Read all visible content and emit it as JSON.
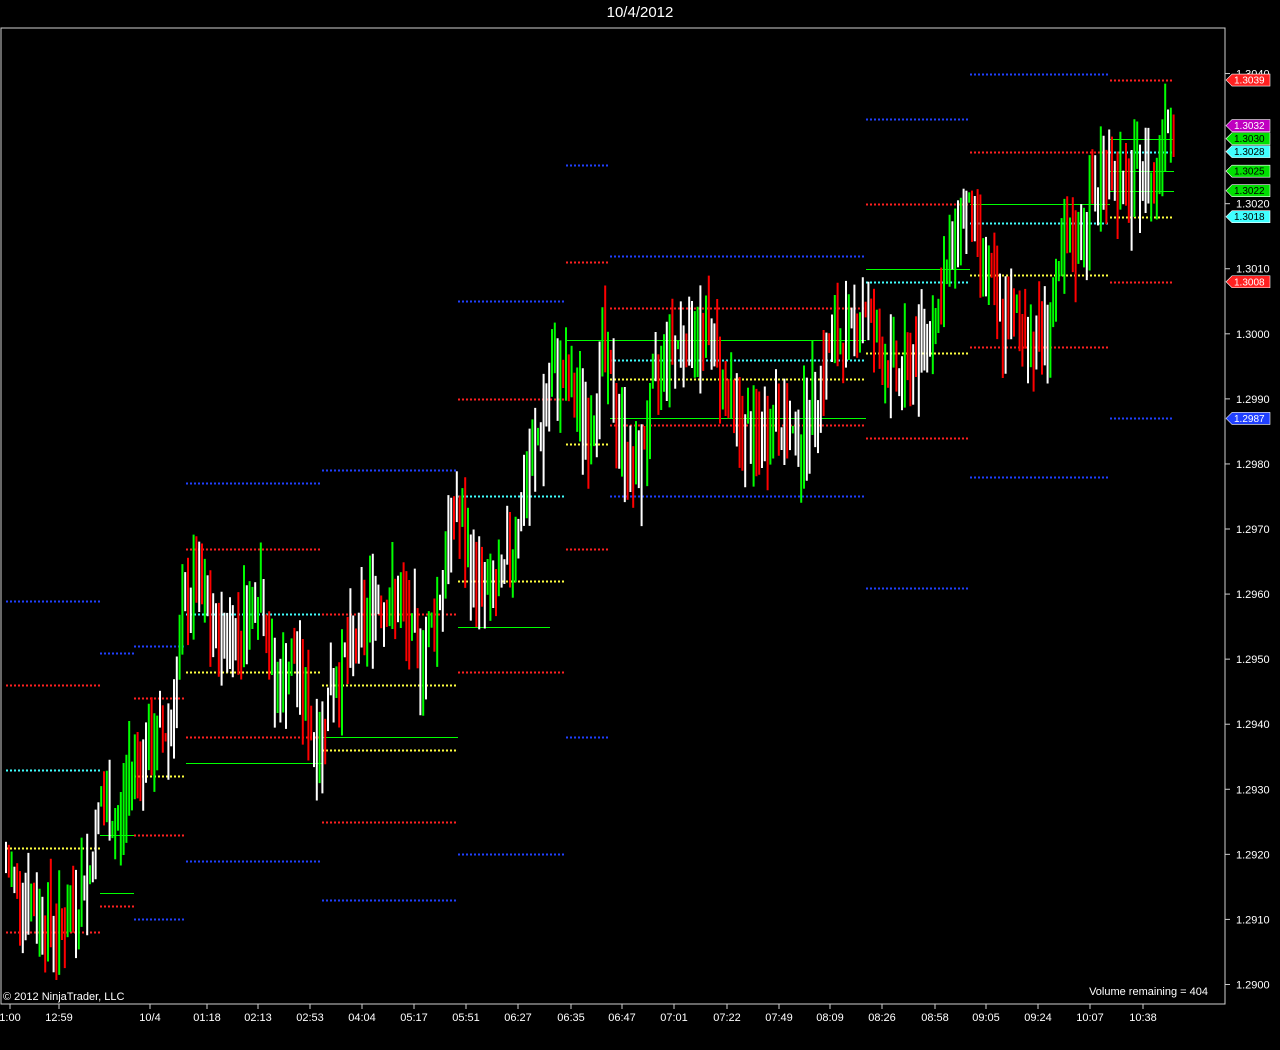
{
  "window": {
    "title": "10/4/2012"
  },
  "footer": {
    "copyright": "© 2012 NinjaTrader, LLC",
    "volume_remaining": "Volume remaining = 404"
  },
  "colors": {
    "background": "#000000",
    "up_bar": "#00ff00",
    "down_bar": "#ff0000",
    "neutral_bar": "#ffffff",
    "level_red": "#ff2020",
    "level_blue": "#2040ff",
    "level_cyan": "#40ffff",
    "level_yellow": "#ffff40",
    "level_green": "#00ff00"
  },
  "chart_data": {
    "type": "candlestick",
    "ylim": [
      1.2897,
      1.3047
    ],
    "y_ticks": [
      "1.3040",
      "1.3020",
      "1.3010",
      "1.3000",
      "1.2990",
      "1.2980",
      "1.2970",
      "1.2960",
      "1.2950",
      "1.2940",
      "1.2930",
      "1.2920",
      "1.2910",
      "1.2900"
    ],
    "x_ticks": [
      "1:00",
      "12:59",
      "10/4",
      "01:18",
      "02:13",
      "02:53",
      "04:04",
      "05:17",
      "05:51",
      "06:27",
      "06:35",
      "06:47",
      "07:01",
      "07:22",
      "07:49",
      "08:09",
      "08:26",
      "08:58",
      "09:05",
      "09:24",
      "10:07",
      "10:38"
    ],
    "price_tags": [
      {
        "label": "1.3039",
        "value": 1.3039,
        "color": "#ff2020"
      },
      {
        "label": "1.3032",
        "value": 1.3032,
        "color": "#c000c0"
      },
      {
        "label": "1.3030",
        "value": 1.303,
        "color": "#00e000"
      },
      {
        "label": "1.3028",
        "value": 1.3028,
        "color": "#40ffff"
      },
      {
        "label": "1.3025",
        "value": 1.3025,
        "color": "#00e000"
      },
      {
        "label": "1.3022",
        "value": 1.3022,
        "color": "#00e000"
      },
      {
        "label": "1.3018",
        "value": 1.3018,
        "color": "#40ffff"
      },
      {
        "label": "1.3008",
        "value": 1.3008,
        "color": "#ff2020"
      },
      {
        "label": "1.2987",
        "value": 1.2987,
        "color": "#2040ff"
      }
    ],
    "path_anchors": [
      [
        6,
        1.2918
      ],
      [
        40,
        1.2911
      ],
      [
        60,
        1.2908
      ],
      [
        90,
        1.2918
      ],
      [
        100,
        1.2928
      ],
      [
        120,
        1.2924
      ],
      [
        130,
        1.2934
      ],
      [
        150,
        1.2936
      ],
      [
        170,
        1.294
      ],
      [
        185,
        1.2958
      ],
      [
        195,
        1.2962
      ],
      [
        215,
        1.2953
      ],
      [
        240,
        1.2955
      ],
      [
        260,
        1.2962
      ],
      [
        275,
        1.2945
      ],
      [
        295,
        1.295
      ],
      [
        310,
        1.294
      ],
      [
        318,
        1.2936
      ],
      [
        330,
        1.2946
      ],
      [
        355,
        1.2952
      ],
      [
        375,
        1.296
      ],
      [
        400,
        1.2958
      ],
      [
        420,
        1.295
      ],
      [
        440,
        1.296
      ],
      [
        455,
        1.2974
      ],
      [
        470,
        1.2964
      ],
      [
        485,
        1.296
      ],
      [
        500,
        1.296
      ],
      [
        520,
        1.2973
      ],
      [
        540,
        1.2985
      ],
      [
        555,
        1.2995
      ],
      [
        575,
        1.299
      ],
      [
        590,
        1.2985
      ],
      [
        602,
        1.2998
      ],
      [
        615,
        1.2988
      ],
      [
        635,
        1.2977
      ],
      [
        650,
        1.2988
      ],
      [
        665,
        1.2998
      ],
      [
        690,
        1.3
      ],
      [
        710,
        1.3
      ],
      [
        725,
        1.2992
      ],
      [
        740,
        1.2985
      ],
      [
        760,
        1.2983
      ],
      [
        775,
        1.2988
      ],
      [
        795,
        1.2983
      ],
      [
        810,
        1.2988
      ],
      [
        830,
        1.2998
      ],
      [
        850,
        1.3
      ],
      [
        865,
        1.3005
      ],
      [
        880,
        1.2997
      ],
      [
        900,
        1.2993
      ],
      [
        920,
        1.2998
      ],
      [
        940,
        1.3005
      ],
      [
        955,
        1.3015
      ],
      [
        965,
        1.302
      ],
      [
        985,
        1.301
      ],
      [
        1000,
        1.3002
      ],
      [
        1020,
        1.3002
      ],
      [
        1035,
        1.2999
      ],
      [
        1050,
        1.3002
      ],
      [
        1065,
        1.3012
      ],
      [
        1080,
        1.3015
      ],
      [
        1095,
        1.3022
      ],
      [
        1110,
        1.3027
      ],
      [
        1125,
        1.302
      ],
      [
        1140,
        1.3025
      ],
      [
        1155,
        1.3023
      ],
      [
        1165,
        1.3035
      ],
      [
        1175,
        1.3033
      ]
    ],
    "levels": [
      {
        "x1": 6,
        "x2": 100,
        "y": 1.2933,
        "color": "#40ffff"
      },
      {
        "x1": 6,
        "x2": 100,
        "y": 1.2946,
        "color": "#ff2020"
      },
      {
        "x1": 6,
        "x2": 100,
        "y": 1.2959,
        "color": "#2040ff"
      },
      {
        "x1": 6,
        "x2": 100,
        "y": 1.2921,
        "color": "#ffff40"
      },
      {
        "x1": 6,
        "x2": 100,
        "y": 1.2908,
        "color": "#ff2020"
      },
      {
        "x1": 100,
        "x2": 134,
        "y": 1.2951,
        "color": "#2040ff"
      },
      {
        "x1": 100,
        "x2": 134,
        "y": 1.2923,
        "color": "#00ff00",
        "solid": true
      },
      {
        "x1": 100,
        "x2": 134,
        "y": 1.2914,
        "color": "#00ff00",
        "solid": true
      },
      {
        "x1": 100,
        "x2": 134,
        "y": 1.2912,
        "color": "#ff2020"
      },
      {
        "x1": 134,
        "x2": 186,
        "y": 1.2952,
        "color": "#2040ff"
      },
      {
        "x1": 134,
        "x2": 186,
        "y": 1.2944,
        "color": "#ff2020"
      },
      {
        "x1": 134,
        "x2": 186,
        "y": 1.2932,
        "color": "#ffff40"
      },
      {
        "x1": 134,
        "x2": 186,
        "y": 1.2923,
        "color": "#ff2020"
      },
      {
        "x1": 134,
        "x2": 186,
        "y": 1.291,
        "color": "#2040ff"
      },
      {
        "x1": 186,
        "x2": 322,
        "y": 1.2977,
        "color": "#2040ff"
      },
      {
        "x1": 186,
        "x2": 322,
        "y": 1.2967,
        "color": "#ff2020"
      },
      {
        "x1": 186,
        "x2": 322,
        "y": 1.2957,
        "color": "#40ffff"
      },
      {
        "x1": 186,
        "x2": 322,
        "y": 1.2948,
        "color": "#ffff40"
      },
      {
        "x1": 186,
        "x2": 322,
        "y": 1.2938,
        "color": "#ff2020"
      },
      {
        "x1": 186,
        "x2": 322,
        "y": 1.2919,
        "color": "#2040ff"
      },
      {
        "x1": 186,
        "x2": 322,
        "y": 1.2934,
        "color": "#00ff00",
        "solid": true
      },
      {
        "x1": 322,
        "x2": 458,
        "y": 1.2979,
        "color": "#2040ff"
      },
      {
        "x1": 322,
        "x2": 458,
        "y": 1.2957,
        "color": "#ff2020"
      },
      {
        "x1": 322,
        "x2": 458,
        "y": 1.2946,
        "color": "#ffff40"
      },
      {
        "x1": 322,
        "x2": 458,
        "y": 1.2936,
        "color": "#ffff40"
      },
      {
        "x1": 322,
        "x2": 458,
        "y": 1.2925,
        "color": "#ff2020"
      },
      {
        "x1": 322,
        "x2": 458,
        "y": 1.2913,
        "color": "#2040ff"
      },
      {
        "x1": 322,
        "x2": 458,
        "y": 1.2938,
        "color": "#00ff00",
        "solid": true
      },
      {
        "x1": 458,
        "x2": 566,
        "y": 1.3005,
        "color": "#2040ff"
      },
      {
        "x1": 458,
        "x2": 566,
        "y": 1.299,
        "color": "#ff2020"
      },
      {
        "x1": 458,
        "x2": 566,
        "y": 1.2975,
        "color": "#40ffff"
      },
      {
        "x1": 458,
        "x2": 566,
        "y": 1.2962,
        "color": "#ffff40"
      },
      {
        "x1": 458,
        "x2": 566,
        "y": 1.2948,
        "color": "#ff2020"
      },
      {
        "x1": 458,
        "x2": 566,
        "y": 1.292,
        "color": "#2040ff"
      },
      {
        "x1": 458,
        "x2": 550,
        "y": 1.2955,
        "color": "#00ff00",
        "solid": true
      },
      {
        "x1": 566,
        "x2": 610,
        "y": 1.3026,
        "color": "#2040ff"
      },
      {
        "x1": 566,
        "x2": 610,
        "y": 1.3011,
        "color": "#ff2020"
      },
      {
        "x1": 566,
        "x2": 610,
        "y": 1.2983,
        "color": "#ffff40"
      },
      {
        "x1": 566,
        "x2": 610,
        "y": 1.2967,
        "color": "#ff2020"
      },
      {
        "x1": 566,
        "x2": 610,
        "y": 1.2938,
        "color": "#2040ff"
      },
      {
        "x1": 610,
        "x2": 866,
        "y": 1.3012,
        "color": "#2040ff"
      },
      {
        "x1": 610,
        "x2": 866,
        "y": 1.3004,
        "color": "#ff2020"
      },
      {
        "x1": 610,
        "x2": 866,
        "y": 1.2996,
        "color": "#40ffff"
      },
      {
        "x1": 610,
        "x2": 866,
        "y": 1.2993,
        "color": "#ffff40"
      },
      {
        "x1": 610,
        "x2": 866,
        "y": 1.2986,
        "color": "#ff2020"
      },
      {
        "x1": 610,
        "x2": 866,
        "y": 1.2975,
        "color": "#2040ff"
      },
      {
        "x1": 566,
        "x2": 866,
        "y": 1.2999,
        "color": "#00ff00",
        "solid": true
      },
      {
        "x1": 610,
        "x2": 866,
        "y": 1.2987,
        "color": "#00ff00",
        "solid": true
      },
      {
        "x1": 866,
        "x2": 970,
        "y": 1.3033,
        "color": "#2040ff"
      },
      {
        "x1": 866,
        "x2": 970,
        "y": 1.302,
        "color": "#ff2020"
      },
      {
        "x1": 866,
        "x2": 970,
        "y": 1.3008,
        "color": "#40ffff"
      },
      {
        "x1": 866,
        "x2": 970,
        "y": 1.2997,
        "color": "#ffff40"
      },
      {
        "x1": 866,
        "x2": 970,
        "y": 1.2984,
        "color": "#ff2020"
      },
      {
        "x1": 866,
        "x2": 970,
        "y": 1.2961,
        "color": "#2040ff"
      },
      {
        "x1": 866,
        "x2": 970,
        "y": 1.301,
        "color": "#00ff00",
        "solid": true
      },
      {
        "x1": 970,
        "x2": 1110,
        "y": 1.304,
        "color": "#2040ff"
      },
      {
        "x1": 970,
        "x2": 1110,
        "y": 1.3028,
        "color": "#ff2020"
      },
      {
        "x1": 970,
        "x2": 1110,
        "y": 1.3017,
        "color": "#40ffff"
      },
      {
        "x1": 970,
        "x2": 1110,
        "y": 1.3009,
        "color": "#ffff40"
      },
      {
        "x1": 970,
        "x2": 1110,
        "y": 1.2998,
        "color": "#ff2020"
      },
      {
        "x1": 970,
        "x2": 1110,
        "y": 1.2978,
        "color": "#2040ff"
      },
      {
        "x1": 970,
        "x2": 1110,
        "y": 1.302,
        "color": "#00ff00",
        "solid": true
      },
      {
        "x1": 1110,
        "x2": 1174,
        "y": 1.3039,
        "color": "#ff2020"
      },
      {
        "x1": 1110,
        "x2": 1174,
        "y": 1.3028,
        "color": "#40ffff"
      },
      {
        "x1": 1110,
        "x2": 1174,
        "y": 1.3018,
        "color": "#ffff40"
      },
      {
        "x1": 1110,
        "x2": 1174,
        "y": 1.3008,
        "color": "#ff2020"
      },
      {
        "x1": 1110,
        "x2": 1174,
        "y": 1.2987,
        "color": "#2040ff"
      },
      {
        "x1": 1110,
        "x2": 1174,
        "y": 1.303,
        "color": "#00ff00",
        "solid": true
      },
      {
        "x1": 1110,
        "x2": 1174,
        "y": 1.3025,
        "color": "#00ff00",
        "solid": true
      },
      {
        "x1": 1110,
        "x2": 1174,
        "y": 1.3022,
        "color": "#00ff00",
        "solid": true
      }
    ]
  }
}
